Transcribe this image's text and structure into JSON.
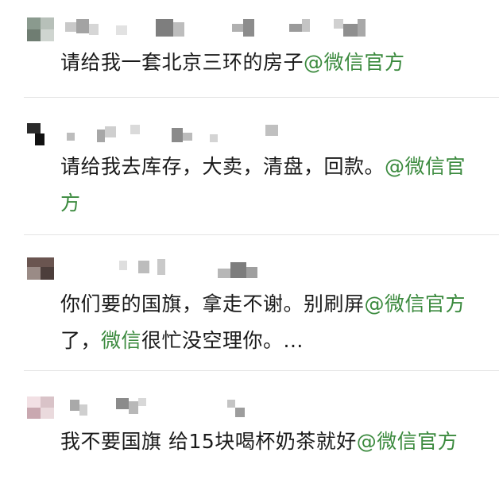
{
  "colors": {
    "text": "#1a1a1a",
    "mention": "#3b8a3e",
    "divider": "#e3e3e3",
    "background": "#ffffff"
  },
  "posts": [
    {
      "avatar": "pixelated-avatar",
      "username": "",
      "text_before": "请给我一套北京三环的房子",
      "mention": "@微信官方",
      "text_after": ""
    },
    {
      "avatar": "pixelated-avatar",
      "username": "",
      "text_before": "请给我去库存，大卖，清盘，回款。",
      "mention": "@微信官方",
      "text_after": ""
    },
    {
      "avatar": "pixelated-avatar",
      "username": "",
      "text_before": "你们要的国旗，拿走不谢。别刷屏",
      "mention": "@微信官方",
      "text_middle": "了，",
      "mention2": "微信",
      "text_after": "很忙没空理你。..."
    },
    {
      "avatar": "pixelated-avatar",
      "username": "",
      "text_before": "我不要国旗 给15块喝杯奶茶就好",
      "mention": "@微信官方",
      "text_after": ""
    }
  ]
}
